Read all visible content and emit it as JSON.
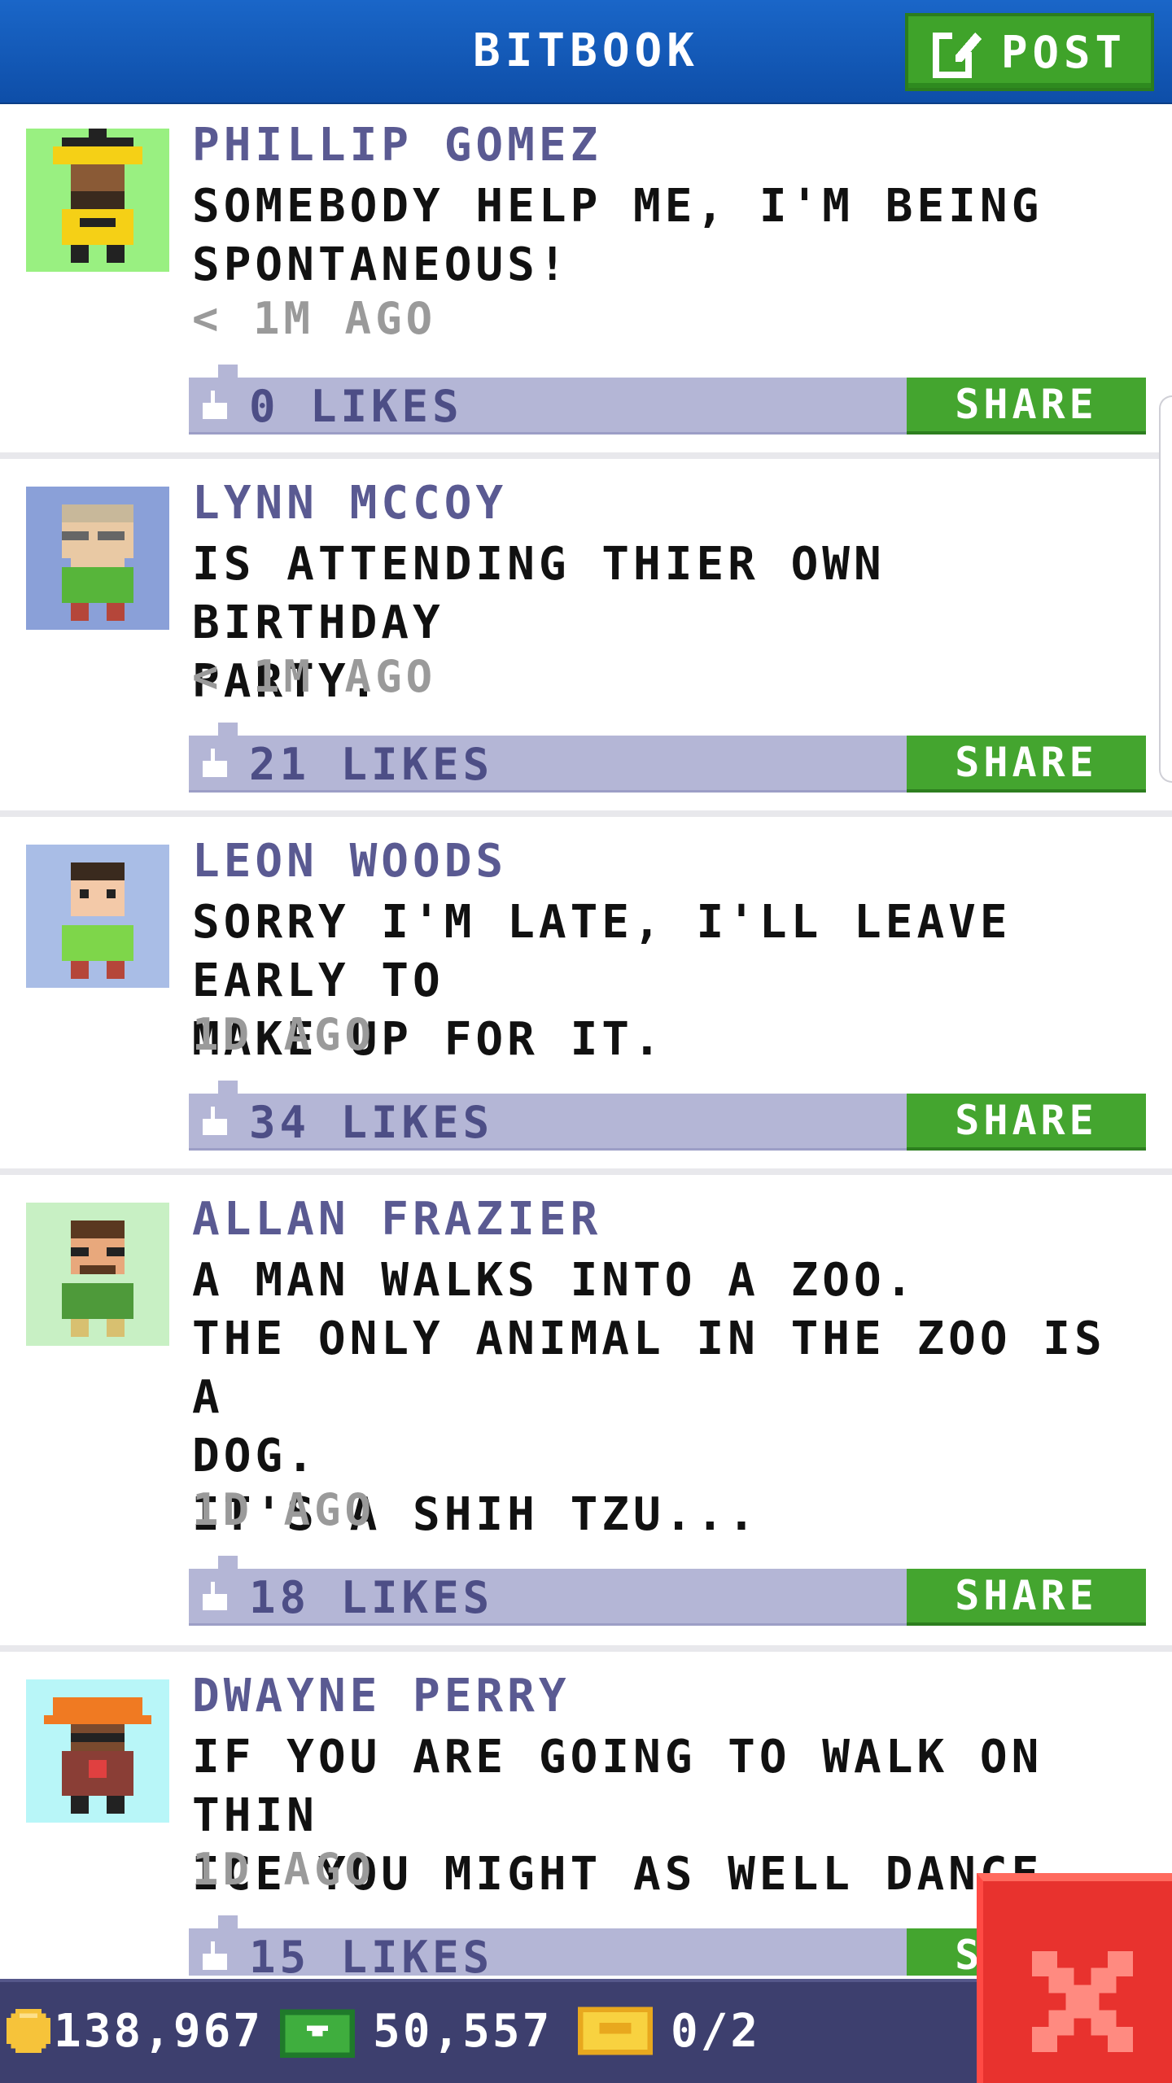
{
  "header": {
    "title": "BITBOOK",
    "post_label": "POST"
  },
  "posts": [
    {
      "author": "PHILLIP GOMEZ",
      "text": "SOMEBODY HELP ME, I'M BEING\nSPONTANEOUS!",
      "time": "< 1M AGO",
      "likes": "0 LIKES",
      "share": "SHARE",
      "avatar_bg": "#99f081"
    },
    {
      "author": "LYNN MCCOY",
      "text": "IS ATTENDING THIER OWN BIRTHDAY\nPARTY.",
      "time": "< 1M AGO",
      "likes": "21 LIKES",
      "share": "SHARE",
      "avatar_bg": "#8aa0d8"
    },
    {
      "author": "LEON WOODS",
      "text": "SORRY I'M LATE, I'LL LEAVE EARLY TO\nMAKE UP FOR IT.",
      "time": "1D AGO",
      "likes": "34 LIKES",
      "share": "SHARE",
      "avatar_bg": "#a9bde6"
    },
    {
      "author": "ALLAN FRAZIER",
      "text": "A MAN WALKS INTO A ZOO.\nTHE ONLY ANIMAL IN THE ZOO IS A\nDOG.\nIT'S A SHIH TZU...",
      "time": "1D AGO",
      "likes": "18 LIKES",
      "share": "SHARE",
      "avatar_bg": "#c8f0c4"
    },
    {
      "author": "DWAYNE PERRY",
      "text": "IF YOU ARE GOING TO WALK ON THIN\nICE YOU MIGHT AS WELL DANCE.",
      "time": "1D AGO",
      "likes": "15 LIKES",
      "share": "SHARE",
      "avatar_bg": "#b8f6f8"
    }
  ],
  "status": {
    "coins": "138,967",
    "bux": "50,557",
    "tickets": "0/2"
  },
  "colors": {
    "header": "#1a5fbf",
    "green": "#44a52f",
    "like_bar": "#b4b6d6",
    "close": "#e8322e"
  }
}
